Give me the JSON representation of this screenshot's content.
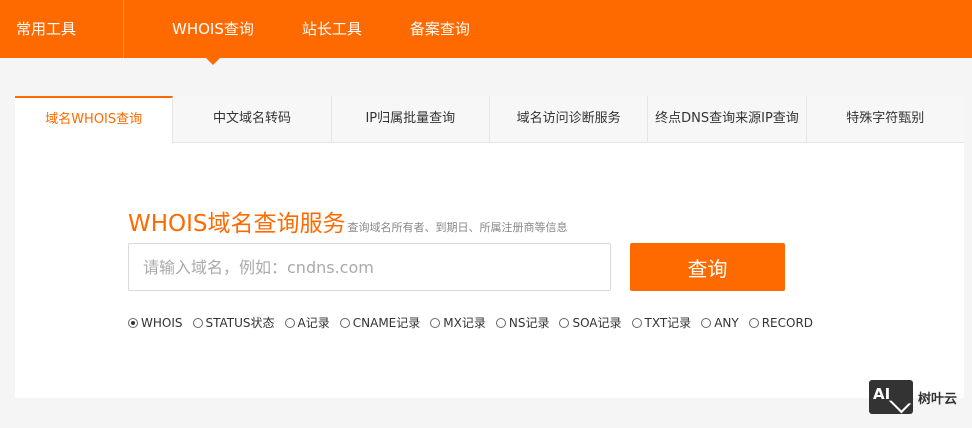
{
  "topnav": {
    "brand": "常用工具",
    "items": [
      "WHOIS查询",
      "站长工具",
      "备案查询"
    ]
  },
  "tabs": [
    "域名WHOIS查询",
    "中文域名转码",
    "IP归属批量查询",
    "域名访问诊断服务",
    "终点DNS查询来源IP查询",
    "特殊字符甄别"
  ],
  "headline": {
    "title": "WHOIS域名查询服务",
    "subtitle": "查询域名所有者、到期日、所属注册商等信息"
  },
  "search": {
    "placeholder": "请输入域名，例如：cndns.com",
    "value": "",
    "button_label": "查询"
  },
  "record_types": [
    "WHOIS",
    "STATUS状态",
    "A记录",
    "CNAME记录",
    "MX记录",
    "NS记录",
    "SOA记录",
    "TXT记录",
    "ANY",
    "RECORD"
  ],
  "selected_record_type": "WHOIS",
  "watermark": {
    "logo_text": "AI",
    "text": "树叶云"
  },
  "colors": {
    "accent": "#ff6a00",
    "background": "#f5f5f5"
  }
}
